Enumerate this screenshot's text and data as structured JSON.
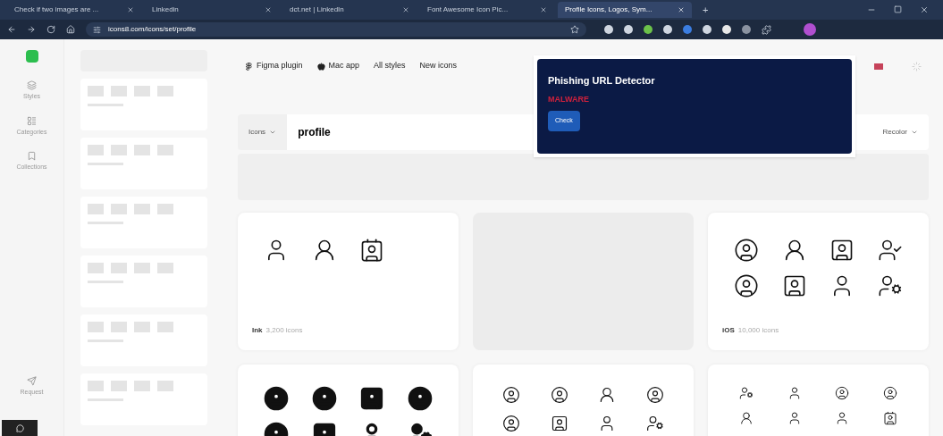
{
  "browser": {
    "tabs": [
      {
        "title": "Check if two images are ...",
        "selected": false
      },
      {
        "title": "Linkedin",
        "selected": false
      },
      {
        "title": "dct.net | LinkedIn",
        "selected": false
      },
      {
        "title": "Font Awesome Icon Pic...",
        "selected": false
      },
      {
        "title": "Profile Icons, Logos, Sym...",
        "selected": true
      }
    ],
    "new_tab": "+",
    "address": "icons8.com/icons/set/profile"
  },
  "rail": {
    "items": [
      {
        "label": "Styles"
      },
      {
        "label": "Categories"
      },
      {
        "label": "Collections"
      }
    ],
    "bottom": {
      "label": "Request"
    }
  },
  "nav": [
    {
      "label": "Figma plugin",
      "kind": "figma"
    },
    {
      "label": "Mac app",
      "kind": "apple"
    },
    {
      "label": "All styles",
      "kind": "plain"
    },
    {
      "label": "New icons",
      "kind": "plain"
    }
  ],
  "search": {
    "scope": "Icons",
    "value": "profile"
  },
  "recolor": "Recolor",
  "popup": {
    "title": "Phishing URL Detector",
    "verdict": "MALWARE",
    "button": "Check"
  },
  "cards": [
    {
      "kind": "outline-set",
      "style": "Ink",
      "count": "3,200 icons"
    },
    {
      "kind": "loading"
    },
    {
      "kind": "outline-set",
      "style": "iOS",
      "count": "10,000 icons"
    },
    {
      "kind": "partial"
    },
    {
      "kind": "partial"
    },
    {
      "kind": "partial"
    }
  ]
}
